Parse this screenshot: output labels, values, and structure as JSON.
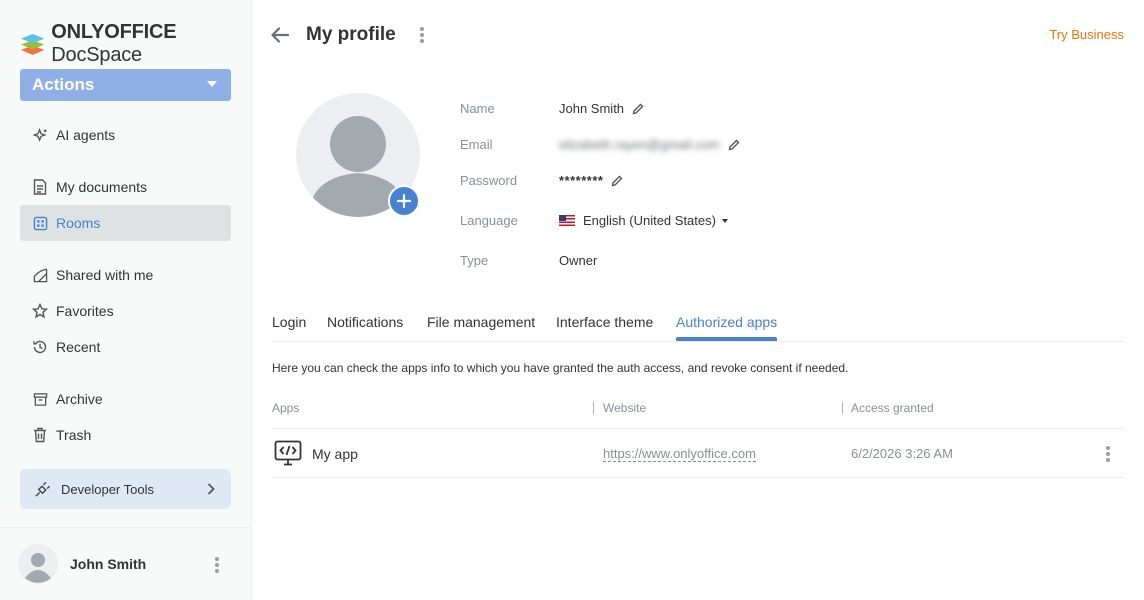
{
  "brand": {
    "name_bold": "ONLYOFFICE",
    "name_rest": " DocSpace"
  },
  "sidebar": {
    "actions_label": "Actions",
    "items": [
      {
        "label": "AI agents",
        "icon": "ai-agents-icon"
      },
      {
        "label": "My documents",
        "icon": "document-icon"
      },
      {
        "label": "Rooms",
        "icon": "rooms-icon",
        "active": true
      },
      {
        "label": "Shared with me",
        "icon": "shared-icon"
      },
      {
        "label": "Favorites",
        "icon": "star-icon"
      },
      {
        "label": "Recent",
        "icon": "history-icon"
      },
      {
        "label": "Archive",
        "icon": "archive-icon"
      },
      {
        "label": "Trash",
        "icon": "trash-icon"
      }
    ],
    "developer_tools_label": "Developer Tools",
    "user_name": "John Smith"
  },
  "header": {
    "title": "My profile",
    "try_business": "Try Business"
  },
  "profile": {
    "name_label": "Name",
    "name_value": "John Smith",
    "email_label": "Email",
    "email_value": "elizabeth.rayen@gmail.com",
    "password_label": "Password",
    "password_value": "********",
    "language_label": "Language",
    "language_value": "English (United States)",
    "type_label": "Type",
    "type_value": "Owner"
  },
  "tabs": [
    {
      "label": "Login"
    },
    {
      "label": "Notifications"
    },
    {
      "label": "File management"
    },
    {
      "label": "Interface theme"
    },
    {
      "label": "Authorized apps",
      "active": true
    }
  ],
  "authorized_apps": {
    "description": "Here you can check the apps info to which you have granted the auth access, and revoke consent if needed.",
    "columns": [
      "Apps",
      "Website",
      "Access granted"
    ],
    "rows": [
      {
        "app": "My app",
        "website": "https://www.onlyoffice.com",
        "granted": "6/2/2026 3:26 AM"
      }
    ]
  },
  "colors": {
    "accent": "#4781d1",
    "actions_button": "#8fb0e6",
    "try_business": "#ed7309",
    "active_nav_bg": "#dfe2e3"
  }
}
